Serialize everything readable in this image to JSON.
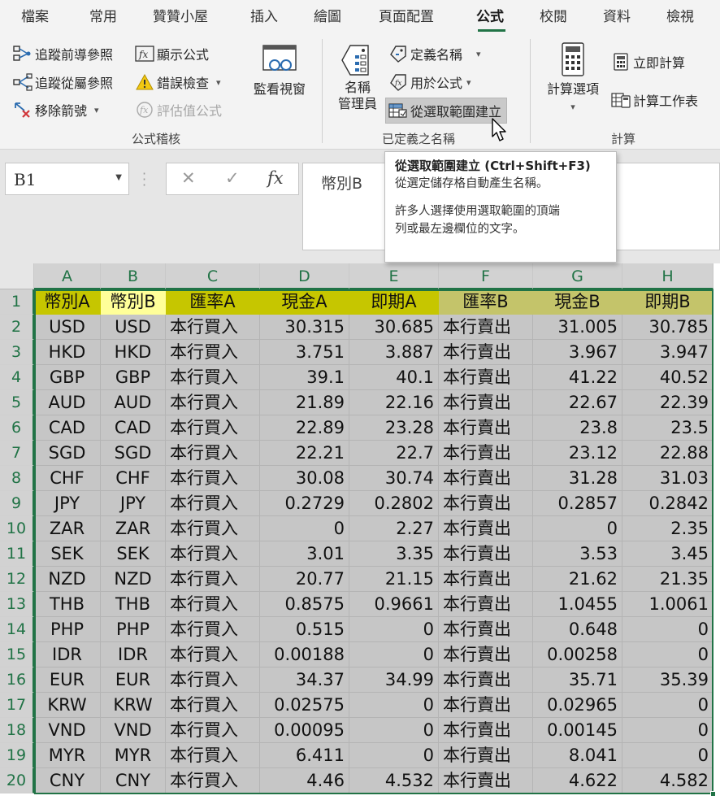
{
  "tabs": [
    {
      "label": "檔案",
      "active": false
    },
    {
      "label": "常用",
      "active": false
    },
    {
      "label": "贊贊小屋",
      "active": false
    },
    {
      "label": "插入",
      "active": false
    },
    {
      "label": "繪圖",
      "active": false
    },
    {
      "label": "頁面配置",
      "active": false
    },
    {
      "label": "公式",
      "active": true
    },
    {
      "label": "校閱",
      "active": false
    },
    {
      "label": "資料",
      "active": false
    },
    {
      "label": "檢視",
      "active": false
    }
  ],
  "ribbon": {
    "auditing": {
      "trace_precedents": "追蹤前導參照",
      "trace_dependents": "追蹤從屬參照",
      "remove_arrows": "移除箭號",
      "show_formulas": "顯示公式",
      "error_checking": "錯誤檢查",
      "evaluate_formula": "評估值公式",
      "watch_window": "監看視窗",
      "group_label": "公式稽核"
    },
    "names": {
      "name_manager_line1": "名稱",
      "name_manager_line2": "管理員",
      "define_name": "定義名稱",
      "use_in_formula": "用於公式",
      "create_from_selection": "從選取範圍建立",
      "group_label": "已定義之名稱"
    },
    "calculation": {
      "calc_options": "計算選項",
      "calc_now": "立即計算",
      "calc_sheet": "計算工作表",
      "group_label": "計算"
    }
  },
  "formula_bar": {
    "name_box": "B1",
    "cancel_symbol": "✕",
    "enter_symbol": "✓",
    "fx_symbol": "fx",
    "content": "幣別B"
  },
  "tooltip": {
    "title": "從選取範圍建立 (Ctrl+Shift+F3)",
    "line1": "從選定儲存格自動產生名稱。",
    "line2": "許多人選擇使用選取範圍的頂端",
    "line3": "列或最左邊欄位的文字。"
  },
  "columns": [
    "A",
    "B",
    "C",
    "D",
    "E",
    "F",
    "G",
    "H"
  ],
  "header_row": [
    "幣別A",
    "幣別B",
    "匯率A",
    "現金A",
    "即期A",
    "匯率B",
    "現金B",
    "即期B"
  ],
  "rows": [
    [
      "USD",
      "USD",
      "本行買入",
      "30.315",
      "30.685",
      "本行賣出",
      "31.005",
      "30.785"
    ],
    [
      "HKD",
      "HKD",
      "本行買入",
      "3.751",
      "3.887",
      "本行賣出",
      "3.967",
      "3.947"
    ],
    [
      "GBP",
      "GBP",
      "本行買入",
      "39.1",
      "40.1",
      "本行賣出",
      "41.22",
      "40.52"
    ],
    [
      "AUD",
      "AUD",
      "本行買入",
      "21.89",
      "22.16",
      "本行賣出",
      "22.67",
      "22.39"
    ],
    [
      "CAD",
      "CAD",
      "本行買入",
      "22.89",
      "23.28",
      "本行賣出",
      "23.8",
      "23.5"
    ],
    [
      "SGD",
      "SGD",
      "本行買入",
      "22.21",
      "22.7",
      "本行賣出",
      "23.12",
      "22.88"
    ],
    [
      "CHF",
      "CHF",
      "本行買入",
      "30.08",
      "30.74",
      "本行賣出",
      "31.28",
      "31.03"
    ],
    [
      "JPY",
      "JPY",
      "本行買入",
      "0.2729",
      "0.2802",
      "本行賣出",
      "0.2857",
      "0.2842"
    ],
    [
      "ZAR",
      "ZAR",
      "本行買入",
      "0",
      "2.27",
      "本行賣出",
      "0",
      "2.35"
    ],
    [
      "SEK",
      "SEK",
      "本行買入",
      "3.01",
      "3.35",
      "本行賣出",
      "3.53",
      "3.45"
    ],
    [
      "NZD",
      "NZD",
      "本行買入",
      "20.77",
      "21.15",
      "本行賣出",
      "21.62",
      "21.35"
    ],
    [
      "THB",
      "THB",
      "本行買入",
      "0.8575",
      "0.9661",
      "本行賣出",
      "1.0455",
      "1.0061"
    ],
    [
      "PHP",
      "PHP",
      "本行買入",
      "0.515",
      "0",
      "本行賣出",
      "0.648",
      "0"
    ],
    [
      "IDR",
      "IDR",
      "本行買入",
      "0.00188",
      "0",
      "本行賣出",
      "0.00258",
      "0"
    ],
    [
      "EUR",
      "EUR",
      "本行買入",
      "34.37",
      "34.99",
      "本行賣出",
      "35.71",
      "35.39"
    ],
    [
      "KRW",
      "KRW",
      "本行買入",
      "0.02575",
      "0",
      "本行賣出",
      "0.02965",
      "0"
    ],
    [
      "VND",
      "VND",
      "本行買入",
      "0.00095",
      "0",
      "本行賣出",
      "0.00145",
      "0"
    ],
    [
      "MYR",
      "MYR",
      "本行買入",
      "6.411",
      "0",
      "本行賣出",
      "8.041",
      "0"
    ],
    [
      "CNY",
      "CNY",
      "本行買入",
      "4.46",
      "4.532",
      "本行賣出",
      "4.622",
      "4.582"
    ]
  ],
  "colors": {
    "accent": "#217346",
    "header_fill_a": "#c6c600",
    "header_fill_active": "#ffff99",
    "header_fill_b": "#c4c46a",
    "selection_fill": "#c6c6c6"
  }
}
